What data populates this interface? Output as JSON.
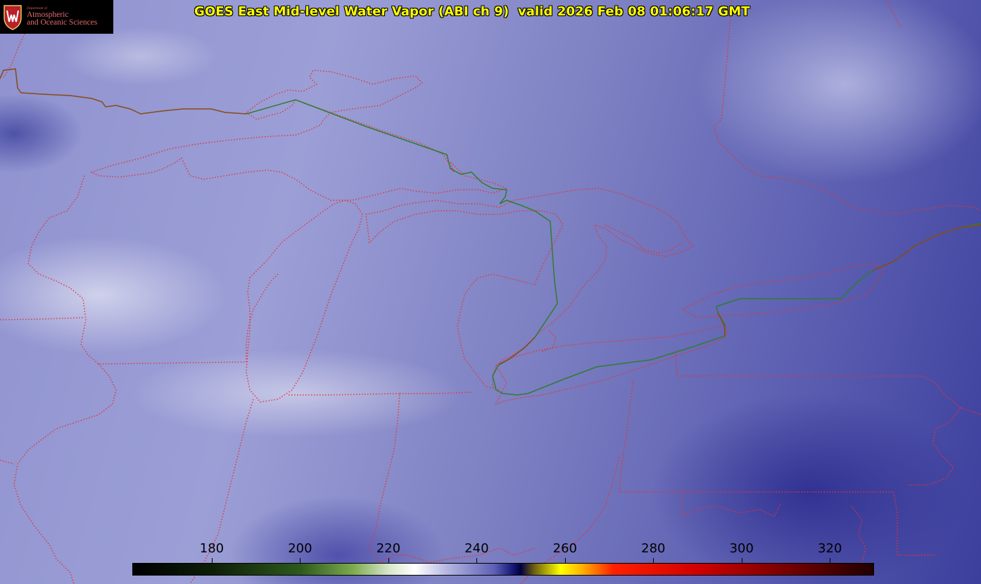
{
  "title": "GOES East Mid-level Water Vapor (ABI ch 9)  valid 2026 Feb 08 01:06:17 GMT",
  "logo": {
    "department": "Department of",
    "line1": "Atmospheric",
    "line2": "and Oceanic Sciences",
    "crest_icon": "uw-crest-icon"
  },
  "colorbar": {
    "tick_labels": [
      "180",
      "200",
      "220",
      "240",
      "260",
      "280",
      "300",
      "320"
    ],
    "tick_values": [
      180,
      200,
      220,
      240,
      260,
      280,
      300,
      320
    ],
    "range": [
      162,
      330
    ],
    "stops": [
      {
        "value": 162,
        "color": "#000000"
      },
      {
        "value": 180,
        "color": "#0d1e08"
      },
      {
        "value": 200,
        "color": "#2d5a1c"
      },
      {
        "value": 212,
        "color": "#7dab4f"
      },
      {
        "value": 220,
        "color": "#d8e6c8"
      },
      {
        "value": 226,
        "color": "#ffffff"
      },
      {
        "value": 233,
        "color": "#b7b9e2"
      },
      {
        "value": 244,
        "color": "#5d60b4"
      },
      {
        "value": 248,
        "color": "#1a1a7a"
      },
      {
        "value": 250,
        "color": "#000040"
      },
      {
        "value": 253,
        "color": "#6b5e10"
      },
      {
        "value": 259,
        "color": "#ffff00"
      },
      {
        "value": 264,
        "color": "#ffb000"
      },
      {
        "value": 271,
        "color": "#ff2000"
      },
      {
        "value": 290,
        "color": "#d00000"
      },
      {
        "value": 308,
        "color": "#800000"
      },
      {
        "value": 330,
        "color": "#200000"
      }
    ]
  },
  "map": {
    "state_border_color": "#e2333a",
    "country_border_color": "#2f7d2f"
  }
}
